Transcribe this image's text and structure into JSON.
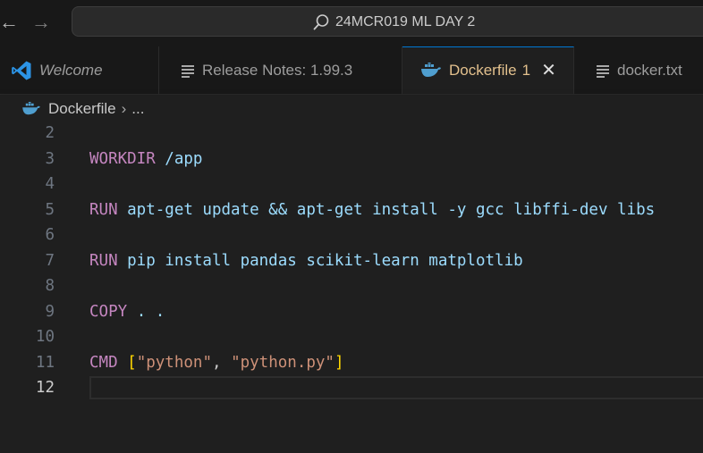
{
  "titlebar": {
    "back_icon": "arrow-left-icon",
    "forward_icon": "arrow-right-icon",
    "search_icon": "search-icon",
    "title": "24MCR019 ML DAY 2"
  },
  "tabs": [
    {
      "label": "Welcome",
      "icon": "vscode-logo-icon",
      "active": false
    },
    {
      "label": "Release Notes: 1.99.3",
      "icon": "file-lines-icon",
      "active": false
    },
    {
      "label": "Dockerfile",
      "badge": "1",
      "icon": "docker-whale-icon",
      "active": true,
      "close_icon": "close-icon"
    },
    {
      "label": "docker.txt",
      "icon": "file-lines-icon",
      "active": false
    }
  ],
  "breadcrumb": {
    "file": "Dockerfile",
    "separator": "›",
    "more": "..."
  },
  "editor": {
    "current_line": 12,
    "lines": [
      {
        "num": "2",
        "tokens": []
      },
      {
        "num": "3",
        "tokens": [
          {
            "t": "WORKDIR",
            "c": "kw"
          },
          {
            "t": " /app",
            "c": "tx"
          }
        ]
      },
      {
        "num": "4",
        "tokens": []
      },
      {
        "num": "5",
        "tokens": [
          {
            "t": "RUN",
            "c": "kw"
          },
          {
            "t": " apt-get update && apt-get install -y gcc libffi-dev libs",
            "c": "tx"
          }
        ]
      },
      {
        "num": "6",
        "tokens": []
      },
      {
        "num": "7",
        "tokens": [
          {
            "t": "RUN",
            "c": "kw"
          },
          {
            "t": " pip install pandas scikit-learn matplotlib",
            "c": "tx"
          }
        ]
      },
      {
        "num": "8",
        "tokens": []
      },
      {
        "num": "9",
        "tokens": [
          {
            "t": "COPY",
            "c": "kw"
          },
          {
            "t": " . .",
            "c": "tx"
          }
        ]
      },
      {
        "num": "10",
        "tokens": []
      },
      {
        "num": "11",
        "tokens": [
          {
            "t": "CMD",
            "c": "kw"
          },
          {
            "t": " ",
            "c": "pl"
          },
          {
            "t": "[",
            "c": "br"
          },
          {
            "t": "\"python\"",
            "c": "st"
          },
          {
            "t": ", ",
            "c": "pl"
          },
          {
            "t": "\"python.py\"",
            "c": "st"
          },
          {
            "t": "]",
            "c": "br"
          }
        ]
      },
      {
        "num": "12",
        "tokens": []
      }
    ]
  }
}
